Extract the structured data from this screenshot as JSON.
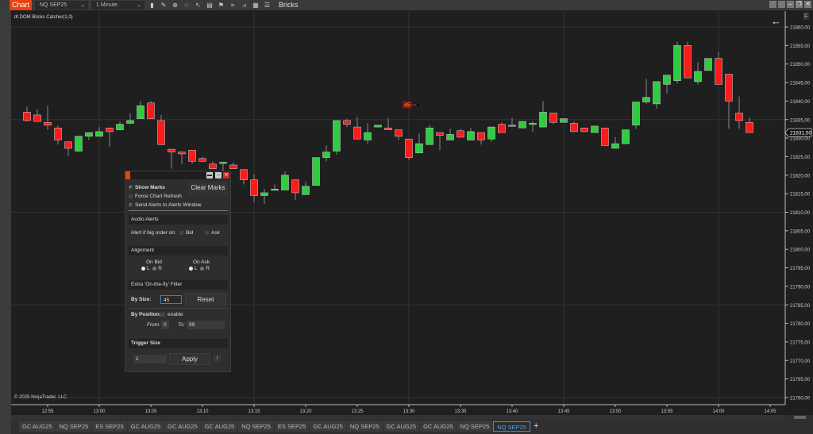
{
  "toolbar": {
    "tab": "Chart",
    "instrument": "NQ SEP25",
    "interval": "1 Minute",
    "template": "Bricks",
    "icons": [
      "bar-type-icon",
      "draw-icon",
      "zoom-in-icon",
      "zoom-out-icon",
      "pointer-icon",
      "data-box-icon",
      "properties-icon",
      "screenshot-icon",
      "strategies-icon",
      "indicators-icon",
      "list-icon"
    ]
  },
  "chart": {
    "indicator_label": "dt DOM Bricks Catcher(1,0)",
    "copyright": "© 2025 NinjaTrader, LLC",
    "last_price": "21831,50",
    "back_icon": "←",
    "f_label": "F"
  },
  "chart_data": {
    "type": "candlestick",
    "instrument": "NQ SEP25",
    "interval": "1 Minute",
    "start_time": "12:53",
    "ylim": [
      21760,
      21860
    ],
    "y_ticks": [
      "21860,00",
      "21855,00",
      "21850,00",
      "21845,00",
      "21840,00",
      "21835,00",
      "21830,00",
      "21825,00",
      "21820,00",
      "21815,00",
      "21810,00",
      "21805,00",
      "21800,00",
      "21795,00",
      "21790,00",
      "21785,00",
      "21780,00",
      "21775,00",
      "21770,00",
      "21765,00",
      "21760,00"
    ],
    "x_ticks": [
      "12:55",
      "13:00",
      "13:05",
      "13:10",
      "13:15",
      "13:20",
      "13:25",
      "13:30",
      "13:35",
      "13:40",
      "13:45",
      "13:50",
      "13:55",
      "14:00",
      "14:05"
    ],
    "ohlc": [
      [
        21837,
        21838.5,
        21834.5,
        21834.75
      ],
      [
        21836.25,
        21837.75,
        21834.5,
        21834.5
      ],
      [
        21834.25,
        21838.75,
        21832.25,
        21833.5
      ],
      [
        21832.75,
        21833.5,
        21828.25,
        21829.5
      ],
      [
        21829,
        21829,
        21825.25,
        21827.25
      ],
      [
        21826.5,
        21830.5,
        21826.25,
        21830.5
      ],
      [
        21830.5,
        21831.5,
        21829.5,
        21831.5
      ],
      [
        21830.5,
        21833,
        21830.5,
        21831.75
      ],
      [
        21832.75,
        21832.75,
        21827.75,
        21831.75
      ],
      [
        21832.25,
        21834.5,
        21832.25,
        21833.75
      ],
      [
        21834,
        21836.75,
        21833.75,
        21834.75
      ],
      [
        21835.25,
        21840,
        21835.25,
        21838.75
      ],
      [
        21839.5,
        21840,
        21835.25,
        21835.25
      ],
      [
        21834.75,
        21836.25,
        21828.25,
        21828.25
      ],
      [
        21827,
        21827,
        21821.75,
        21826.25
      ],
      [
        21826.25,
        21826.25,
        21823,
        21825.75
      ],
      [
        21826.75,
        21826.75,
        21823,
        21823.75
      ],
      [
        21824.5,
        21825,
        21823.75,
        21823.75
      ],
      [
        21823,
        21823.75,
        21821.75,
        21821.75
      ],
      [
        21823.25,
        21823.5,
        21821.25,
        21823.5
      ],
      [
        21822.75,
        21823.5,
        21821.75,
        21821.75
      ],
      [
        21821.5,
        21821.5,
        21817.5,
        21818.75
      ],
      [
        21818.75,
        21820.25,
        21812.75,
        21814.5
      ],
      [
        21814.5,
        21816.25,
        21812.25,
        21815.25
      ],
      [
        21816,
        21817.5,
        21816,
        21816.25
      ],
      [
        21816,
        21821,
        21816,
        21820
      ],
      [
        21818.75,
        21818.75,
        21813.25,
        21815.25
      ],
      [
        21814.75,
        21818.25,
        21814.75,
        21817
      ],
      [
        21817.25,
        21824.75,
        21817.25,
        21824.75
      ],
      [
        21824.75,
        21828,
        21823.75,
        21826.25
      ],
      [
        21826.5,
        21834.75,
        21825.5,
        21834.75
      ],
      [
        21834.75,
        21835.25,
        21833,
        21833.75
      ],
      [
        21833,
        21835.75,
        21829.75,
        21829.75
      ],
      [
        21829.5,
        21834,
        21828.5,
        21831.5
      ],
      [
        21833,
        21833.5,
        21833,
        21833.5
      ],
      [
        21832.75,
        21835.5,
        21832.25,
        21832.25
      ],
      [
        21832.25,
        21832.25,
        21829.5,
        21830.5
      ],
      [
        21829.75,
        21829.75,
        21824,
        21824.75
      ],
      [
        21826,
        21831.25,
        21826,
        21828.5
      ],
      [
        21828.25,
        21833.5,
        21828.25,
        21832.75
      ],
      [
        21831.5,
        21831.5,
        21826.75,
        21830.75
      ],
      [
        21829.5,
        21832.5,
        21829.5,
        21831
      ],
      [
        21832,
        21832.5,
        21830.25,
        21830.25
      ],
      [
        21829.5,
        21832.75,
        21829.5,
        21831.75
      ],
      [
        21831.5,
        21831.5,
        21828.25,
        21829.5
      ],
      [
        21829.75,
        21833,
        21829,
        21833
      ],
      [
        21833.75,
        21834.25,
        21831.5,
        21831.5
      ],
      [
        21833.5,
        21835.5,
        21833.5,
        21833.5
      ],
      [
        21832.75,
        21834.5,
        21832.75,
        21834.5
      ],
      [
        21834,
        21834.5,
        21831.75,
        21834
      ],
      [
        21833,
        21840,
        21833,
        21837
      ],
      [
        21836.75,
        21836.75,
        21833.75,
        21834.25
      ],
      [
        21834.25,
        21835.25,
        21834.25,
        21835.25
      ],
      [
        21834,
        21834.5,
        21831.75,
        21831.75
      ],
      [
        21832.75,
        21832.75,
        21831.75,
        21831.75
      ],
      [
        21831.5,
        21833.25,
        21831.5,
        21833.25
      ],
      [
        21832.75,
        21832.75,
        21828,
        21828
      ],
      [
        21827.25,
        21830.25,
        21827.25,
        21828.5
      ],
      [
        21828.5,
        21832.25,
        21828.5,
        21832.25
      ],
      [
        21833.5,
        21839.75,
        21832.5,
        21839.75
      ],
      [
        21839.75,
        21846,
        21839.25,
        21841
      ],
      [
        21839.25,
        21845.25,
        21838,
        21845.25
      ],
      [
        21844.5,
        21847,
        21842,
        21847
      ],
      [
        21845.5,
        21856,
        21844.75,
        21855
      ],
      [
        21855,
        21856,
        21846.25,
        21846.25
      ],
      [
        21845.25,
        21850.5,
        21844.5,
        21848
      ],
      [
        21848.25,
        21851.5,
        21848.25,
        21851.5
      ],
      [
        21851.5,
        21853.25,
        21844.5,
        21844.5
      ],
      [
        21847.25,
        21847.25,
        21832.5,
        21840
      ],
      [
        21836.75,
        21841.25,
        21832.5,
        21834.75
      ],
      [
        21834.25,
        21835.5,
        21831.5,
        21831.5
      ]
    ],
    "marker": {
      "label": "45",
      "time": "13:30",
      "price": 21839
    }
  },
  "panel": {
    "show_marks": "Show Marks",
    "force_refresh": "Force Chart Refresh",
    "send_alerts": "Send Alerts to Alerts Window",
    "clear_marks": "Clear Marks",
    "audio_title": "Audio Alerts",
    "alert_label": "Alert if big order on:",
    "bid": "Bid",
    "ask": "Ask",
    "alignment_title": "Alignment",
    "on_bid": "On Bid",
    "on_ask": "On Ask",
    "l": "L",
    "r": "R",
    "filter_title": "Extra 'On-the-fly' Filter",
    "by_size": "By Size:",
    "size_value": "45",
    "reset": "Reset",
    "by_position": "By Position:",
    "enable": "enable",
    "from": "From:",
    "from_value": "0",
    "to": "To:",
    "to_value": "99",
    "trigger_title": "Trigger Size",
    "trigger_value": "1",
    "apply": "Apply",
    "info": "i"
  },
  "tabs": [
    "GC AUG25",
    "NQ SEP25",
    "ES SEP25",
    "GC AUG25",
    "GC AUG25",
    "GC AUG25",
    "NQ SEP25",
    "ES SEP25",
    "GC AUG25",
    "NQ SEP25",
    "GC AUG25",
    "GC AUG25",
    "NQ SEP25",
    "NQ SEP25"
  ],
  "add_tab": "+",
  "colors": {
    "up": "#2ecc40",
    "down": "#ff1a1a",
    "accent": "#e8430e"
  }
}
